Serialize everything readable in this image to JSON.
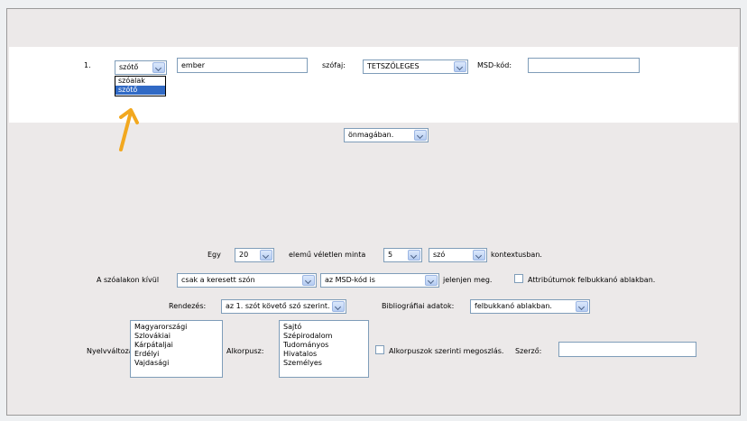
{
  "query": {
    "row_number": "1.",
    "type_select": "szótő",
    "dropdown_options": [
      "szóalak",
      "szótő"
    ],
    "dropdown_highlighted": "szótő",
    "word_value": "ember",
    "pos_label": "szófaj:",
    "pos_select": "TETSZŐLEGES",
    "msd_label": "MSD-kód:",
    "msd_value": ""
  },
  "context_select": "önmagában.",
  "sample": {
    "prefix": "Egy",
    "count": "20",
    "middle": "elemű véletlen minta",
    "context_count": "5",
    "context_unit": "szó",
    "suffix": "kontextusban."
  },
  "display": {
    "label": "A szóalakon kívül",
    "select1": "csak a keresett szón",
    "select2": "az MSD-kód is",
    "suffix": "jelenjen meg.",
    "checkbox_label": "Attribútumok felbukkanó ablakban."
  },
  "sort": {
    "label": "Rendezés:",
    "select": "az 1. szót követő szó szerint.",
    "biblio_label": "Bibliográfiai adatok:",
    "biblio_select": "felbukkanó ablakban."
  },
  "filters": {
    "variety_label": "Nyelvváltozat:",
    "varieties": [
      "Magyarországi",
      "Szlovákiai",
      "Kárpátaljai",
      "Erdélyi",
      "Vajdasági"
    ],
    "subcorpus_label": "Alkorpusz:",
    "subcorpora": [
      "Sajtó",
      "Szépirodalom",
      "Tudományos",
      "Hivatalos",
      "Személyes"
    ],
    "split_label": "Alkorpuszok szerinti megoszlás.",
    "author_label": "Szerző:",
    "author_value": ""
  },
  "annotation_color": "#f2a81f"
}
